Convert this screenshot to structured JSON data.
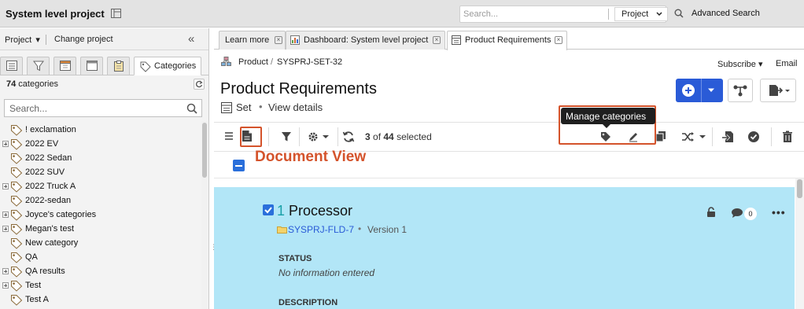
{
  "app": {
    "title": "System level project"
  },
  "search": {
    "placeholder": "Search...",
    "scope": "Project",
    "advanced": "Advanced Search"
  },
  "left": {
    "project_menu": "Project",
    "change_project": "Change project",
    "active_tab": "Categories",
    "count_number": "74",
    "count_suffix": " categories",
    "search_placeholder": "Search...",
    "categories": [
      {
        "label": "! exclamation",
        "expandable": false
      },
      {
        "label": "2022 EV",
        "expandable": true
      },
      {
        "label": "2022 Sedan",
        "expandable": false
      },
      {
        "label": "2022 SUV",
        "expandable": false
      },
      {
        "label": "2022 Truck A",
        "expandable": true
      },
      {
        "label": "2022-sedan",
        "expandable": false
      },
      {
        "label": "Joyce's categories",
        "expandable": true
      },
      {
        "label": "Megan's test",
        "expandable": true
      },
      {
        "label": "New category",
        "expandable": false
      },
      {
        "label": "QA",
        "expandable": false
      },
      {
        "label": "QA results",
        "expandable": true
      },
      {
        "label": "Test",
        "expandable": true
      },
      {
        "label": "Test A",
        "expandable": false
      },
      {
        "label": "",
        "expandable": false
      }
    ]
  },
  "tabs": [
    {
      "label": "Learn more"
    },
    {
      "label": "Dashboard: System level project"
    },
    {
      "label": "Product Requirements"
    }
  ],
  "breadcrumb": {
    "product": "Product",
    "separator": "/",
    "item_id": "SYSPRJ-SET-32"
  },
  "header_links": {
    "subscribe": "Subscribe",
    "email": "Email"
  },
  "page": {
    "title": "Product Requirements",
    "type_label": "Set",
    "dot": "•",
    "view_details": "View details"
  },
  "toolbar": {
    "selected_num": "3",
    "selected_mid": " of ",
    "selected_total": "44",
    "selected_suffix": " selected",
    "tooltip": "Manage categories"
  },
  "annotations": {
    "document_view": "Document View",
    "highlight_color": "#d4532b"
  },
  "item": {
    "number": "1",
    "name": "Processor",
    "id": "SYSPRJ-FLD-7",
    "dot": "•",
    "version": "Version 1",
    "comments": "0",
    "more": "•••",
    "status_label": "STATUS",
    "status_value": "No information entered",
    "description_label": "DESCRIPTION"
  },
  "colors": {
    "accent": "#2a5bd7",
    "card_bg": "#b2e6f7",
    "topbar_bg": "#e3e3e3"
  }
}
